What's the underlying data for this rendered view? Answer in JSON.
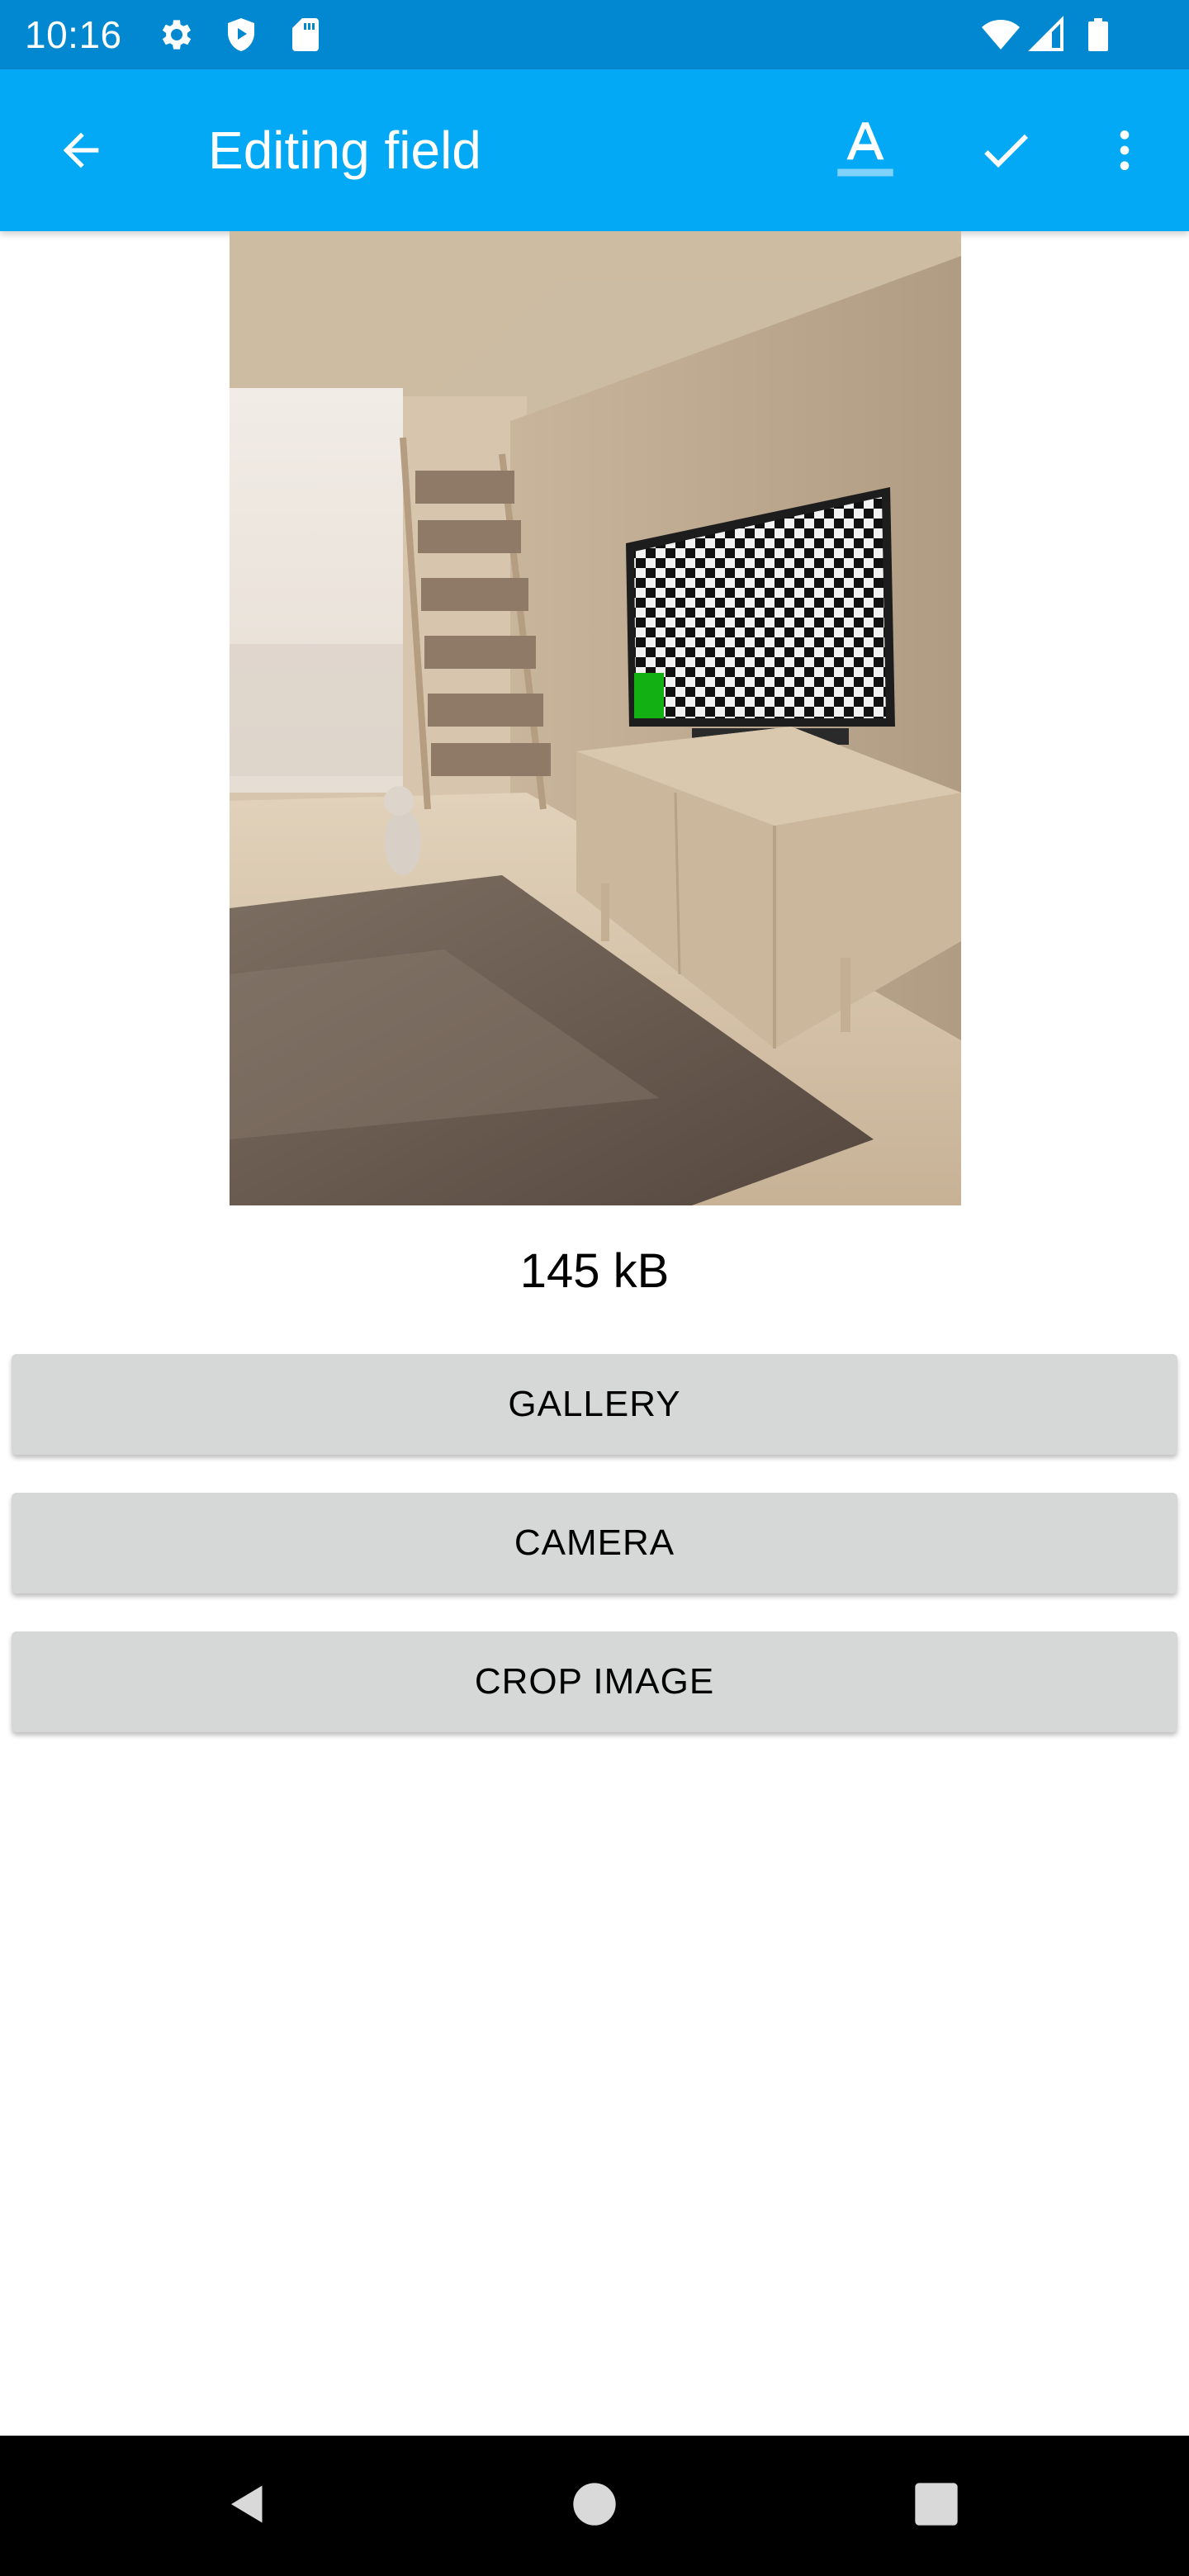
{
  "status_bar": {
    "time": "10:16",
    "left_icons": [
      "settings-icon",
      "shield-play-icon",
      "sd-card-icon"
    ],
    "right_icons": [
      "wifi-icon",
      "cell-signal-icon",
      "battery-icon"
    ]
  },
  "app_bar": {
    "title": "Editing field",
    "background_color": "#03a9f4",
    "status_color": "#0288d1",
    "actions": [
      "text-format-icon",
      "check-icon",
      "more-vert-icon"
    ]
  },
  "preview": {
    "file_size": "145 kB"
  },
  "buttons": {
    "gallery": "GALLERY",
    "camera": "CAMERA",
    "crop": "CROP IMAGE"
  },
  "nav_bar": {
    "buttons": [
      "back-icon",
      "home-icon",
      "recents-icon"
    ]
  }
}
